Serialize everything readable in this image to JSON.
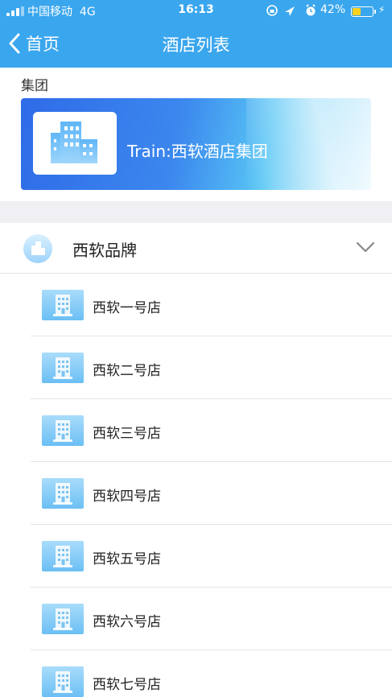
{
  "status_bar": {
    "carrier": "中国移动",
    "network": "4G",
    "time": "16:13",
    "battery": "42%",
    "battery_level": 0.42
  },
  "nav": {
    "back_label": "首页",
    "title": "酒店列表"
  },
  "group": {
    "section_label": "集团",
    "banner_text": "Train:西软酒店集团"
  },
  "brand": {
    "name": "西软品牌"
  },
  "hotels": [
    {
      "name": "西软一号店"
    },
    {
      "name": "西软二号店"
    },
    {
      "name": "西软三号店"
    },
    {
      "name": "西软四号店"
    },
    {
      "name": "西软五号店"
    },
    {
      "name": "西软六号店"
    },
    {
      "name": "西软七号店"
    }
  ],
  "colors": {
    "nav_bg": "#3aa6ee",
    "battery_fill": "#ffd21f"
  }
}
